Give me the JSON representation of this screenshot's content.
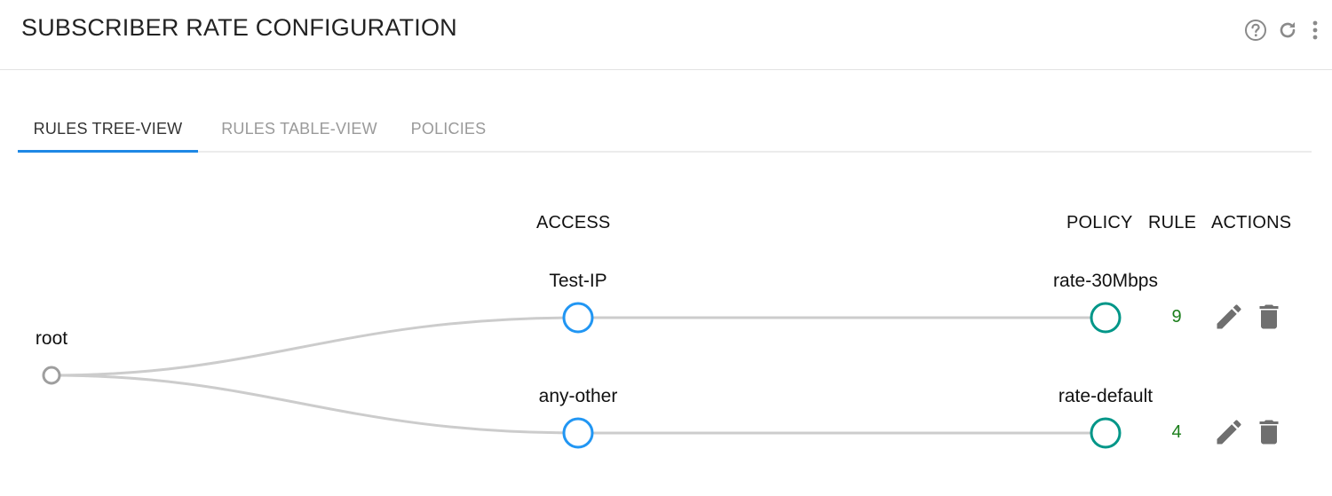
{
  "header": {
    "title": "SUBSCRIBER RATE CONFIGURATION",
    "icons": [
      "help-icon",
      "refresh-icon",
      "more-vert-icon"
    ]
  },
  "tabs": [
    {
      "label": "RULES TREE-VIEW",
      "active": true
    },
    {
      "label": "RULES TABLE-VIEW",
      "active": false
    },
    {
      "label": "POLICIES",
      "active": false
    }
  ],
  "tree": {
    "columns": {
      "access": "ACCESS",
      "policy": "POLICY",
      "rule": "RULE",
      "actions": "ACTIONS"
    },
    "root": {
      "label": "root"
    },
    "rules": [
      {
        "access": "Test-IP",
        "policy": "rate-30Mbps",
        "rule": "9",
        "actions": [
          "edit-icon",
          "delete-icon"
        ]
      },
      {
        "access": "any-other",
        "policy": "rate-default",
        "rule": "4",
        "actions": [
          "edit-icon",
          "delete-icon"
        ]
      }
    ],
    "colors": {
      "access_node": "#2196f3",
      "policy_node": "#009688",
      "root_node": "#9e9e9e",
      "link": "#cccccc",
      "rule_number": "#1b7e1b",
      "tab_active_underline": "#1e88e5"
    }
  }
}
